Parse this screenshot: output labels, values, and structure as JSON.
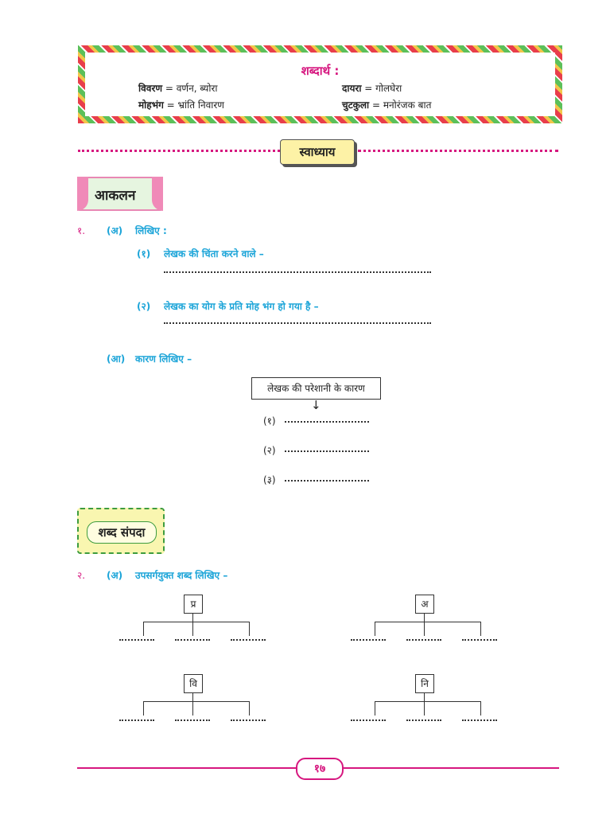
{
  "glossary": {
    "title": "शब्दार्थ :",
    "items": [
      {
        "term": "विवरण",
        "meaning": " = वर्णन, ब्योरा"
      },
      {
        "term": "मोहभंग",
        "meaning": " = भ्रांति निवारण"
      },
      {
        "term": "दायरा",
        "meaning": " = गोलघेरा"
      },
      {
        "term": "चुटकुला",
        "meaning": " = मनोरंजक बात"
      }
    ]
  },
  "swadhyay": "स्वाध्याय",
  "section1": {
    "badge": "आकलन",
    "q_num": "१.",
    "part_a": {
      "label": "(अ)",
      "text": "लिखिए :",
      "sub": [
        {
          "num": "(१)",
          "text": "लेखक की चिंता करने वाले –"
        },
        {
          "num": "(२)",
          "text": "लेखक का योग के प्रति मोह भंग हो गया है –"
        }
      ]
    },
    "part_b": {
      "label": "(आ)",
      "text": "कारण लिखिए  –",
      "box": "लेखक की परेशानी के कारण",
      "arrow": "↓",
      "items": [
        "(१)",
        "(२)",
        "(३)"
      ]
    }
  },
  "section2": {
    "badge": "शब्द संपदा",
    "q_num": "२.",
    "part_a": {
      "label": "(अ)",
      "text": "उपसर्गयुक्त शब्द लिखिए –",
      "prefixes": [
        "प्र",
        "अ",
        "वि",
        "नि"
      ]
    }
  },
  "page_number": "१७",
  "colors": {
    "pink": "#d6177f",
    "cyan": "#1ba4d8",
    "green": "#3d9c3f"
  }
}
